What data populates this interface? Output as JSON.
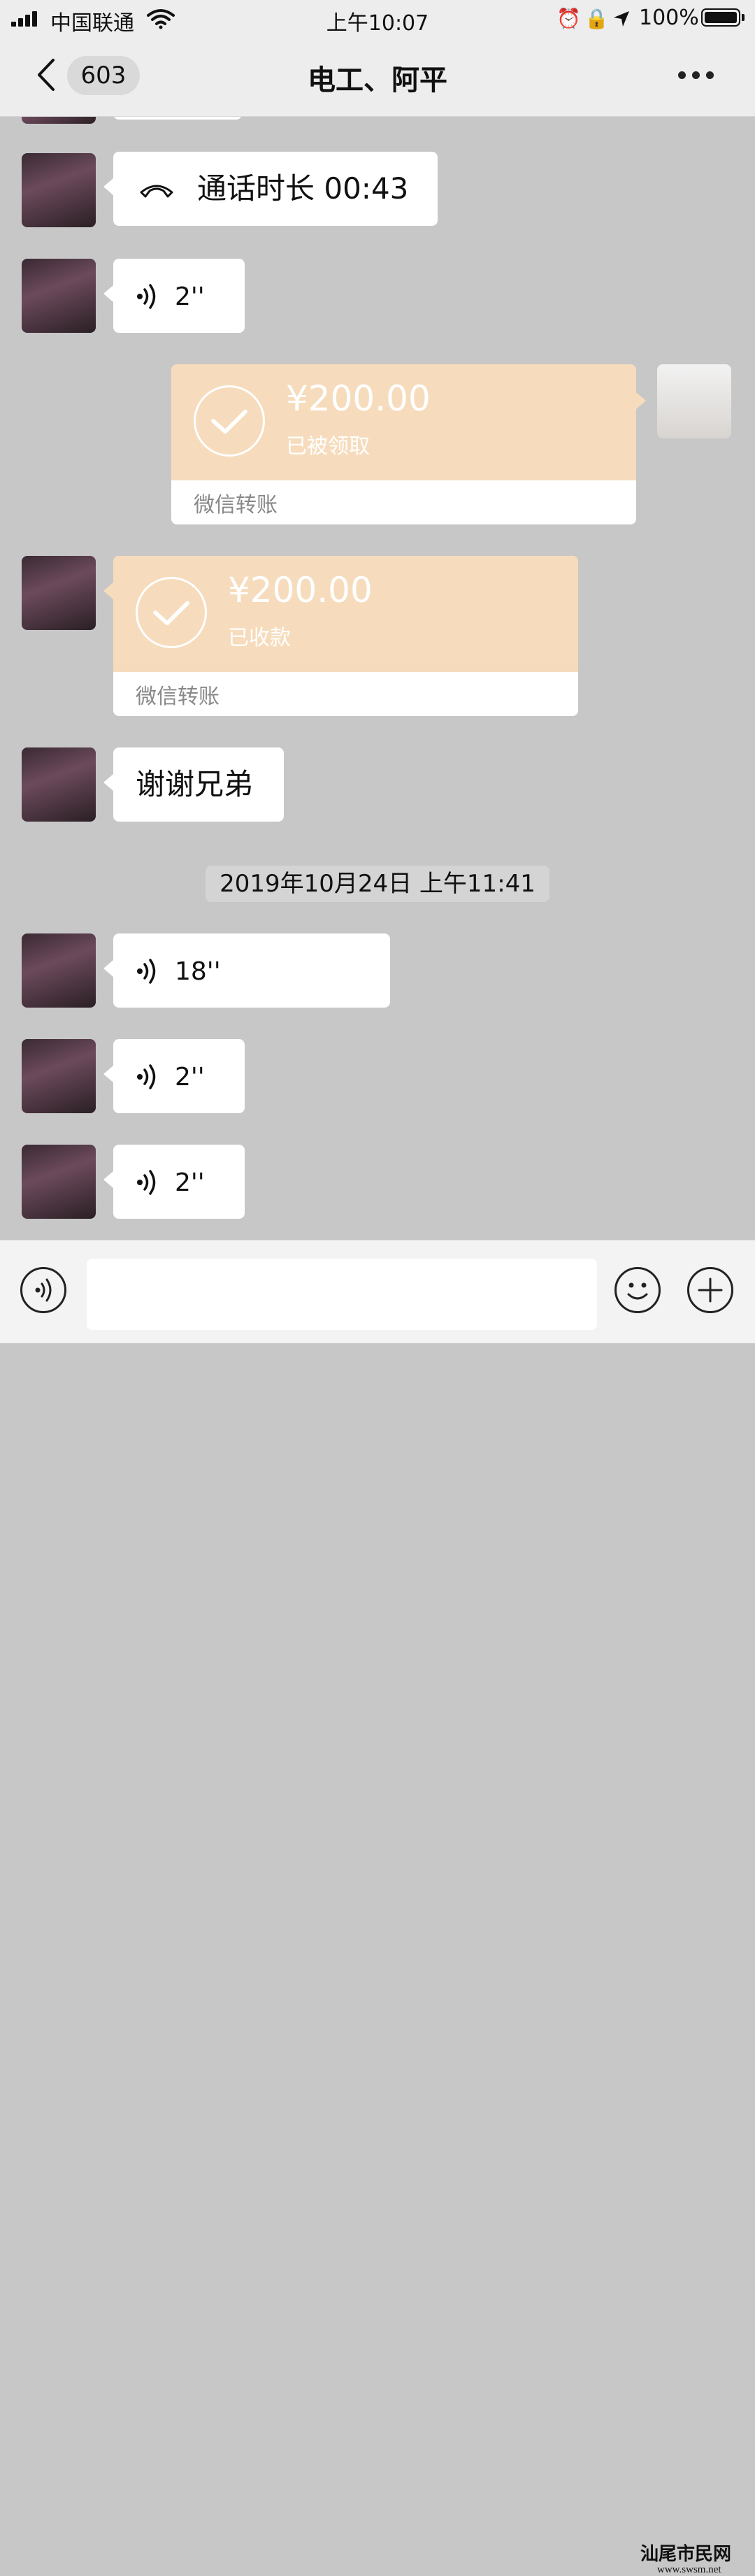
{
  "status_bar": {
    "carrier": "中国联通",
    "time": "上午10:07",
    "battery": "100%",
    "battery_level": 1.0
  },
  "nav": {
    "unread_count": "603",
    "title": "电工、阿平"
  },
  "messages": [
    {
      "side": "left",
      "type": "call",
      "text": "通话时长 00:43"
    },
    {
      "side": "left",
      "type": "voice",
      "duration": "2''"
    },
    {
      "side": "right",
      "type": "transfer",
      "amount": "¥200.00",
      "status": "已被领取",
      "label": "微信转账"
    },
    {
      "side": "left",
      "type": "transfer",
      "amount": "¥200.00",
      "status": "已收款",
      "label": "微信转账"
    },
    {
      "side": "left",
      "type": "text",
      "text": "谢谢兄弟"
    },
    {
      "type": "timestamp",
      "text": "2019年10月24日 上午11:41"
    },
    {
      "side": "left",
      "type": "voice",
      "duration": "18''"
    },
    {
      "side": "left",
      "type": "voice",
      "duration": "2''"
    },
    {
      "side": "left",
      "type": "voice",
      "duration": "2''"
    }
  ],
  "input": {
    "placeholder": ""
  },
  "watermark": {
    "text": "汕尾市民网",
    "url": "www.swsm.net"
  },
  "colors": {
    "transfer_bg": "#f6dcbc",
    "chat_bg": "#c7c7c7",
    "bar_bg": "#ededed"
  }
}
